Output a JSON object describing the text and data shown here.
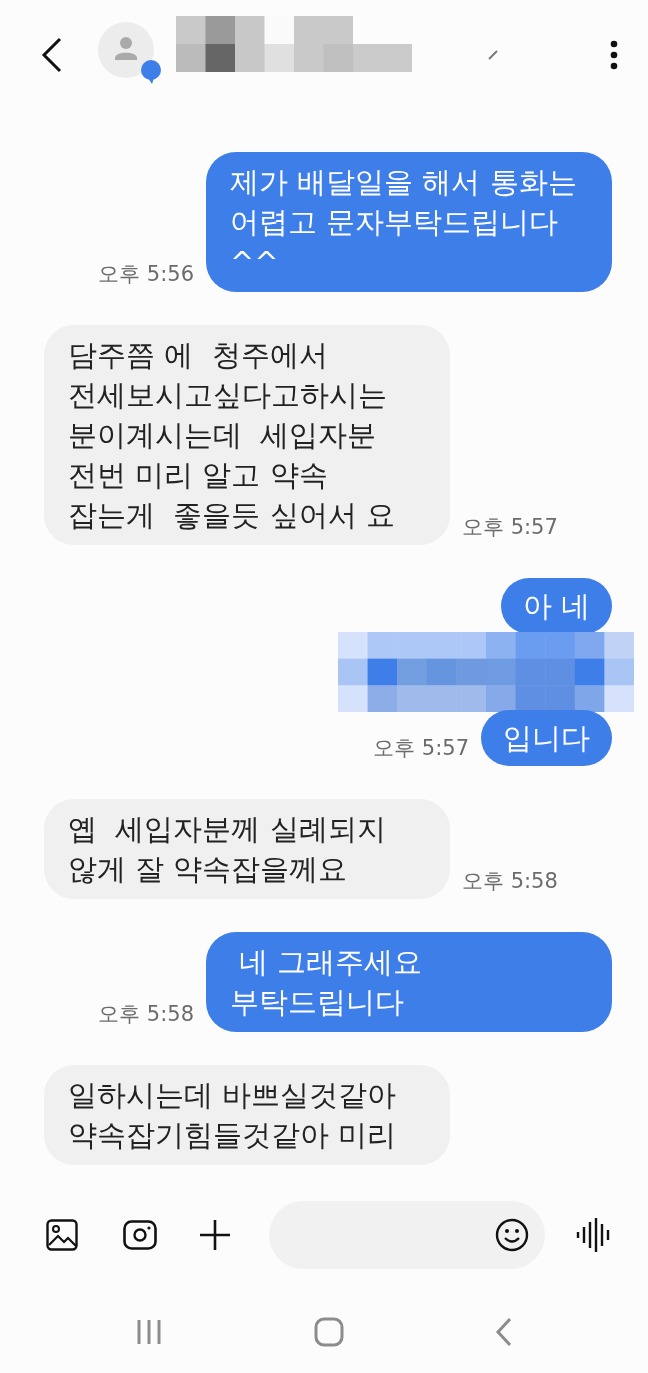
{
  "messages": [
    {
      "kind": "text",
      "sent": true,
      "text": "제가 배달일을 해서 통화는\n어렵고 문자부탁드립니다\n^^",
      "time": "오후 5:56"
    },
    {
      "kind": "text",
      "sent": false,
      "text": "담주쯤 에  청주에서\n전세보시고싶다고하시는\n분이계시는데  세입자분\n전번 미리 알고 약속\n잡는게  좋을듯 싶어서 요",
      "time": "오후 5:57"
    },
    {
      "kind": "text",
      "sent": true,
      "text": "아 네"
    },
    {
      "kind": "redacted",
      "sent": true
    },
    {
      "kind": "text",
      "sent": true,
      "text": "입니다",
      "time": "오후 5:57"
    },
    {
      "kind": "text",
      "sent": false,
      "text": "옙  세입자분께 실례되지\n않게 잘 약속잡을께요",
      "time": "오후 5:58"
    },
    {
      "kind": "text",
      "sent": true,
      "text": " 네 그래주세요\n부탁드립니다",
      "time": "오후 5:58"
    },
    {
      "kind": "text",
      "sent": false,
      "text": "일하시는데 바쁘실것같아\n약속잡기힘들것같아 미리"
    }
  ]
}
